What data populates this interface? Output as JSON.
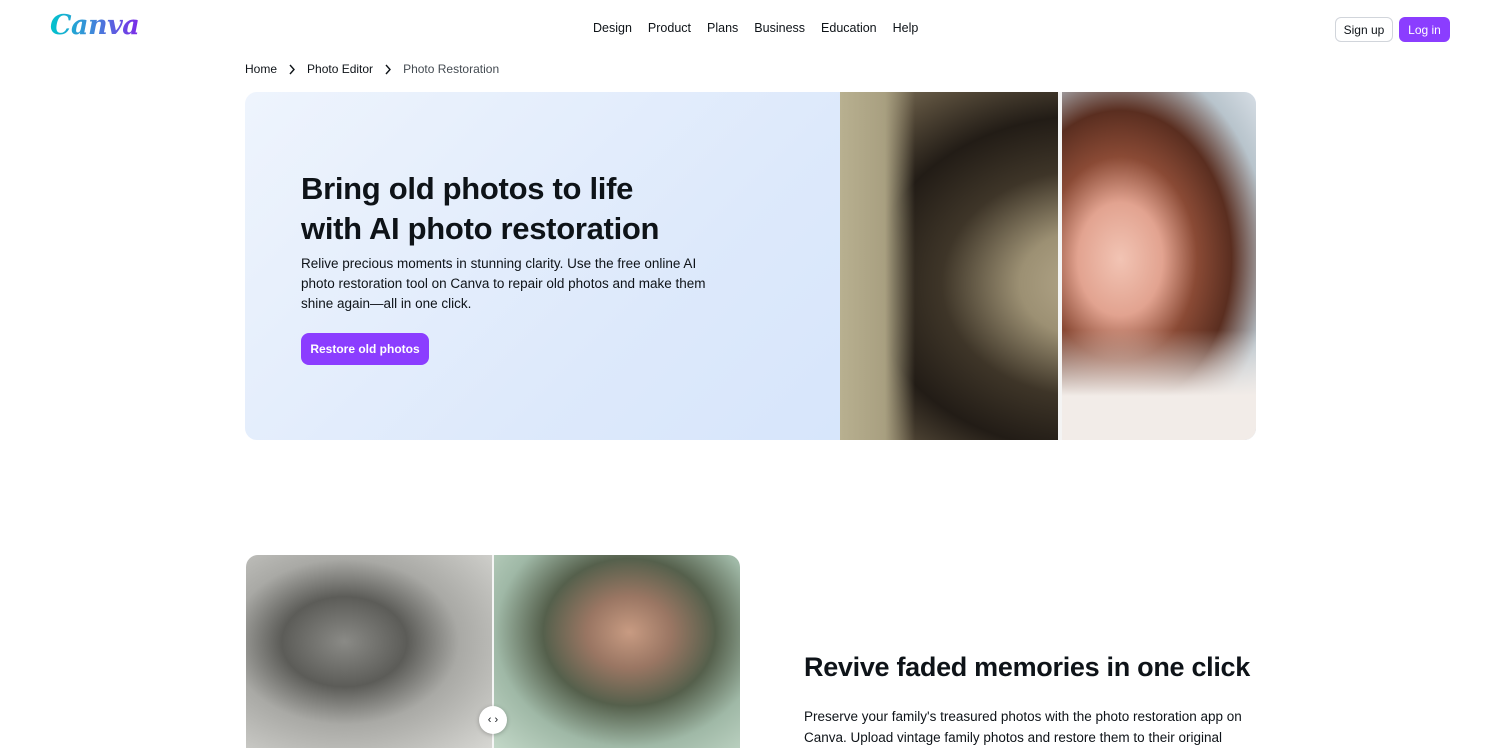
{
  "header": {
    "logo": "Canva",
    "nav": [
      "Design",
      "Product",
      "Plans",
      "Business",
      "Education",
      "Help"
    ],
    "signup_label": "Sign up",
    "login_label": "Log in"
  },
  "breadcrumb": {
    "items": [
      "Home",
      "Photo Editor",
      "Photo Restoration"
    ]
  },
  "hero": {
    "title_line1": "Bring old photos to life",
    "title_line2": "with AI photo restoration",
    "description": "Relive precious moments in stunning clarity. Use the free online AI photo restoration tool on Canva to repair old photos and make them shine again—all in one click.",
    "cta_label": "Restore old photos"
  },
  "section2": {
    "title": "Revive faded memories in one click",
    "description": "Preserve your family's treasured photos with the photo restoration app on Canva. Upload vintage family photos and restore them to their original",
    "slider_glyph": "‹ ›"
  },
  "colors": {
    "brand_purple": "#8b3dff",
    "text_dark": "#0e1318",
    "hero_bg": "#dde9fb"
  }
}
